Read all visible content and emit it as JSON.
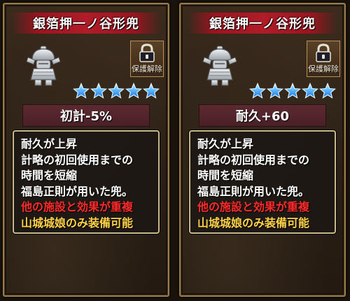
{
  "cards": [
    {
      "title": "銀箔押一ノ谷形兜",
      "release_label": "保護解除",
      "stat": "初計-5%",
      "stars": 5,
      "lines": {
        "l1": "耐久が上昇",
        "l2": "計略の初回使用までの",
        "l3": "時間を短縮",
        "l4": "福島正則が用いた兜。",
        "l5": "他の施設と効果が重複",
        "l6": "山城城娘のみ装備可能"
      }
    },
    {
      "title": "銀箔押一ノ谷形兜",
      "release_label": "保護解除",
      "stat": "耐久+60",
      "stars": 5,
      "lines": {
        "l1": "耐久が上昇",
        "l2": "計略の初回使用までの",
        "l3": "時間を短縮",
        "l4": "福島正則が用いた兜。",
        "l5": "他の施設と効果が重複",
        "l6": "山城城娘のみ装備可能"
      }
    }
  ],
  "colors": {
    "title_band": "#b01c28",
    "star": "#5fb8ff",
    "warning_text": "#ff2a2a",
    "restriction_text": "#ffd24a",
    "frame": "#9a7c4c"
  },
  "icons": {
    "equipment": "armor-helmet-icon",
    "protect": "lock-icon",
    "rarity": "star-icon"
  }
}
